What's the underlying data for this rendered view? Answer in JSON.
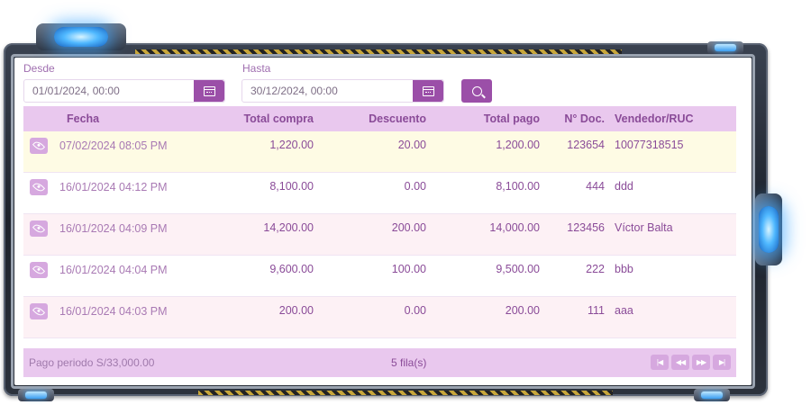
{
  "filters": {
    "desde_label": "Desde",
    "desde_value": "01/01/2024, 00:00",
    "hasta_label": "Hasta",
    "hasta_value": "30/12/2024, 00:00"
  },
  "table": {
    "headers": {
      "fecha": "Fecha",
      "total_compra": "Total compra",
      "descuento": "Descuento",
      "total_pago": "Total pago",
      "doc": "N° Doc.",
      "vendedor": "Vendedor/RUC"
    },
    "rows": [
      {
        "fecha": "07/02/2024 08:05 PM",
        "total_compra": "1,220.00",
        "descuento": "20.00",
        "total_pago": "1,200.00",
        "doc": "123654",
        "vendedor": "10077318515",
        "bg": "#fefbe4"
      },
      {
        "fecha": "16/01/2024 04:12 PM",
        "total_compra": "8,100.00",
        "descuento": "0.00",
        "total_pago": "8,100.00",
        "doc": "444",
        "vendedor": "ddd",
        "bg": "#ffffff"
      },
      {
        "fecha": "16/01/2024 04:09 PM",
        "total_compra": "14,200.00",
        "descuento": "200.00",
        "total_pago": "14,000.00",
        "doc": "123456",
        "vendedor": "Víctor Balta",
        "bg": "#fdf1f5"
      },
      {
        "fecha": "16/01/2024 04:04 PM",
        "total_compra": "9,600.00",
        "descuento": "100.00",
        "total_pago": "9,500.00",
        "doc": "222",
        "vendedor": "bbb",
        "bg": "#ffffff"
      },
      {
        "fecha": "16/01/2024 04:03 PM",
        "total_compra": "200.00",
        "descuento": "0.00",
        "total_pago": "200.00",
        "doc": "111",
        "vendedor": "aaa",
        "bg": "#fdf1f5"
      }
    ]
  },
  "footer": {
    "summary": "Pago periodo S/33,000.00",
    "count": "5 fila(s)"
  },
  "colors": {
    "accent": "#9b4fa8",
    "header_bg": "#e9c8ee",
    "text": "#8a4b98"
  }
}
